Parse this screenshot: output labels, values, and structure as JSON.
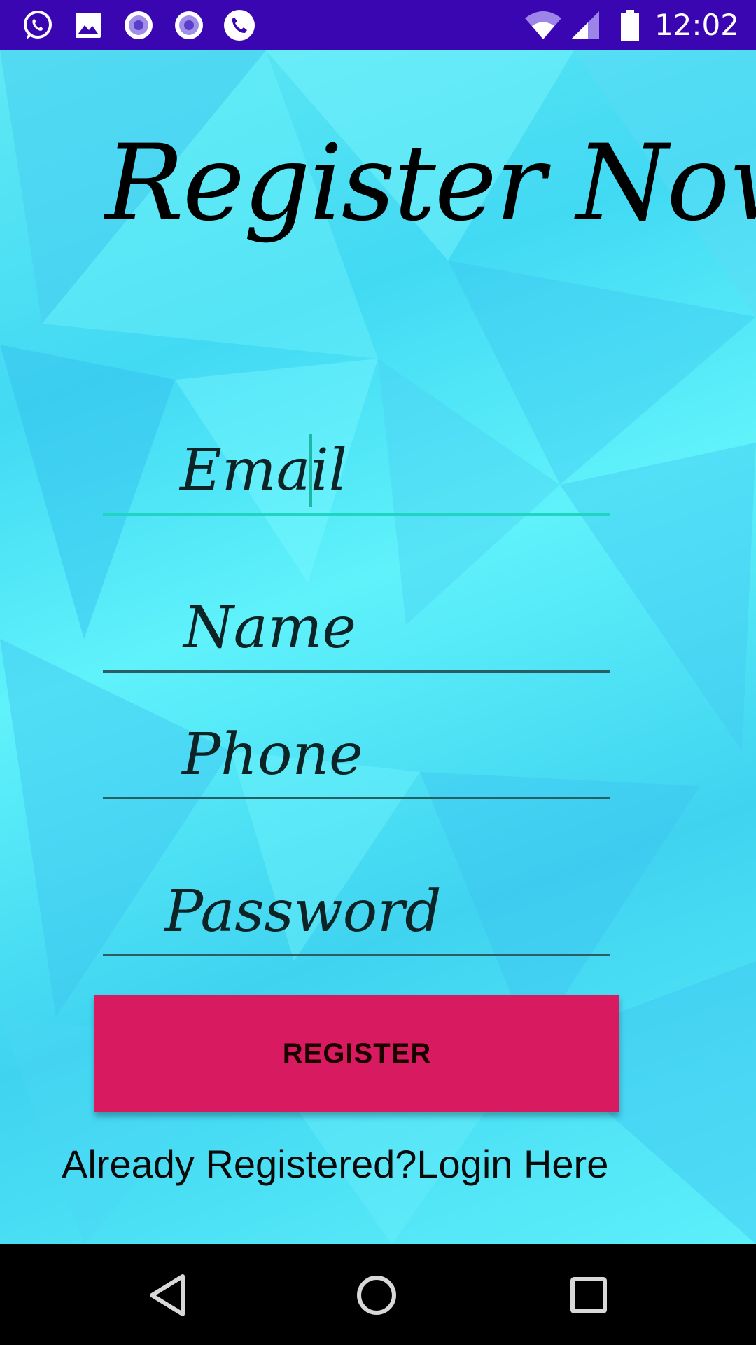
{
  "status_bar": {
    "time": "12:02",
    "left_icons": [
      "whatsapp-icon",
      "image-icon",
      "radio-icon",
      "radio-icon",
      "phone-call-icon"
    ],
    "right_icons": [
      "wifi-icon",
      "signal-icon",
      "battery-icon"
    ],
    "color": "#3a06b2"
  },
  "page": {
    "title": "Register Now"
  },
  "form": {
    "email_label": "Email",
    "name_label": "Name",
    "phone_label": "Phone",
    "password_label": "Password",
    "active_field": "email"
  },
  "register_button": {
    "label": "REGISTER",
    "color": "#d81b60"
  },
  "login_link": {
    "text": "Already Registered?Login Here"
  },
  "nav_bar": {
    "buttons": [
      "back-icon",
      "home-icon",
      "recents-icon"
    ]
  }
}
